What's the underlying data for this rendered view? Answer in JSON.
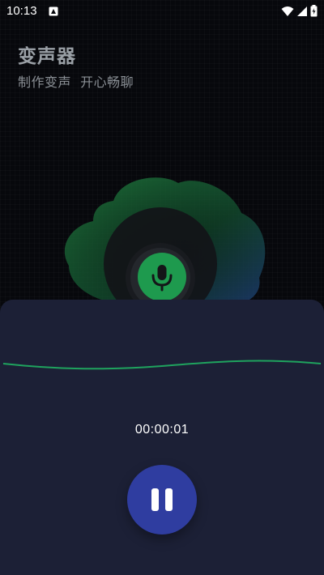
{
  "status_bar": {
    "time": "10:13",
    "icons": [
      "notification-icon",
      "wifi-icon",
      "signal-icon",
      "battery-icon"
    ]
  },
  "header": {
    "title": "变声器",
    "subtitle": "制作变声  开心畅聊"
  },
  "recorder": {
    "timer": "00:00:01",
    "state_icon": "pause-icon",
    "mic_icon": "microphone-icon"
  },
  "colors": {
    "background": "#07080c",
    "sheet": "#1c2036",
    "accent_green": "#1e9a4e",
    "pause_button": "#2f3da0",
    "wave": "#1fa35e"
  }
}
